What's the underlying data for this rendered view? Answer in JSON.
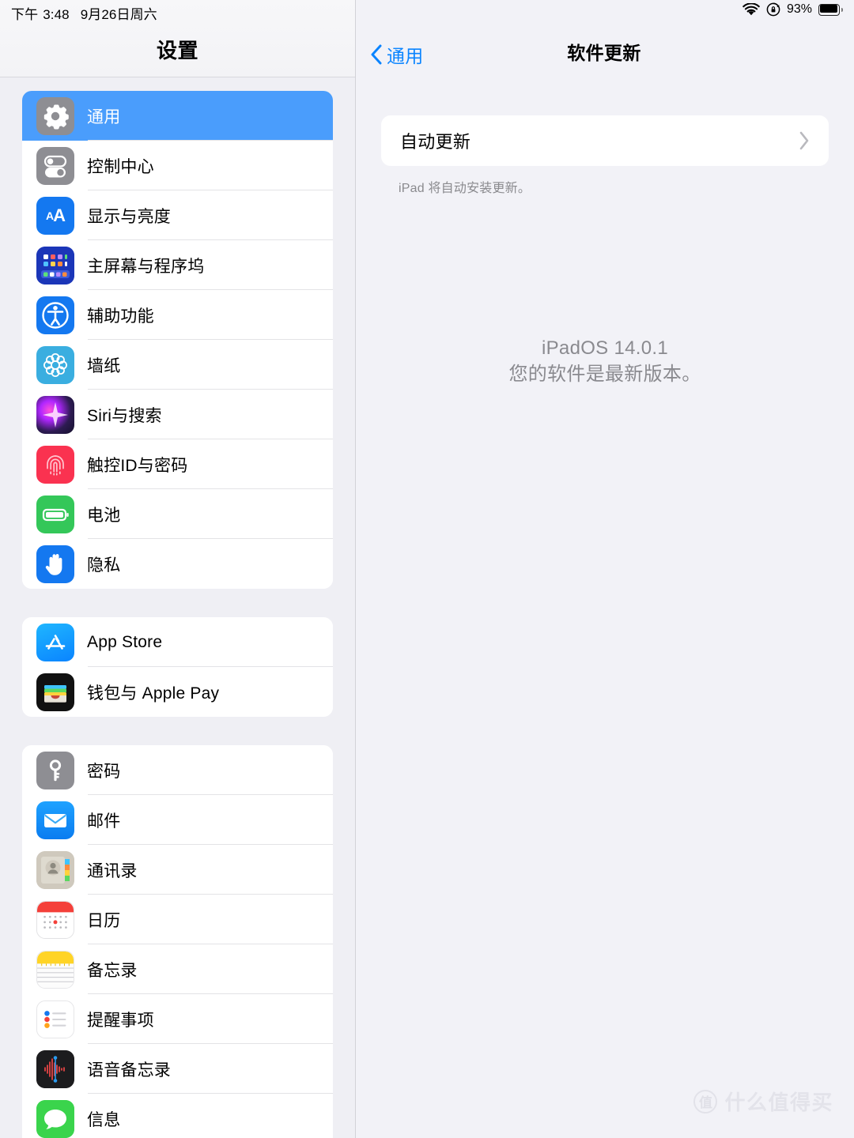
{
  "status_bar": {
    "ampm": "下午",
    "time": "3:48",
    "date": "9月26日周六",
    "wifi_icon": "wifi-icon",
    "rotation_lock_icon": "rotation-lock-icon",
    "battery_percent": "93%",
    "battery_level": 93,
    "battery_icon": "battery-icon"
  },
  "sidebar": {
    "title": "设置",
    "groups": [
      {
        "items": [
          {
            "label": "通用",
            "icon": "gear-icon",
            "selected": true
          },
          {
            "label": "控制中心",
            "icon": "control-center-icon",
            "selected": false
          },
          {
            "label": "显示与亮度",
            "icon": "display-brightness-icon",
            "selected": false
          },
          {
            "label": "主屏幕与程序坞",
            "icon": "home-screen-dock-icon",
            "selected": false
          },
          {
            "label": "辅助功能",
            "icon": "accessibility-icon",
            "selected": false
          },
          {
            "label": "墙纸",
            "icon": "wallpaper-icon",
            "selected": false
          },
          {
            "label": "Siri与搜索",
            "icon": "siri-icon",
            "selected": false
          },
          {
            "label": "触控ID与密码",
            "icon": "touch-id-icon",
            "selected": false
          },
          {
            "label": "电池",
            "icon": "battery-settings-icon",
            "selected": false
          },
          {
            "label": "隐私",
            "icon": "privacy-hand-icon",
            "selected": false
          }
        ]
      },
      {
        "items": [
          {
            "label": "App Store",
            "icon": "app-store-icon",
            "selected": false
          },
          {
            "label": "钱包与 Apple Pay",
            "icon": "wallet-icon",
            "selected": false
          }
        ]
      },
      {
        "items": [
          {
            "label": "密码",
            "icon": "passwords-key-icon",
            "selected": false
          },
          {
            "label": "邮件",
            "icon": "mail-icon",
            "selected": false
          },
          {
            "label": "通讯录",
            "icon": "contacts-icon",
            "selected": false
          },
          {
            "label": "日历",
            "icon": "calendar-icon",
            "selected": false
          },
          {
            "label": "备忘录",
            "icon": "notes-icon",
            "selected": false
          },
          {
            "label": "提醒事项",
            "icon": "reminders-icon",
            "selected": false
          },
          {
            "label": "语音备忘录",
            "icon": "voice-memos-icon",
            "selected": false
          },
          {
            "label": "信息",
            "icon": "messages-icon",
            "selected": false
          }
        ]
      }
    ]
  },
  "detail": {
    "back_label": "通用",
    "back_icon": "chevron-left-icon",
    "title": "软件更新",
    "auto_update_row": {
      "label": "自动更新",
      "chevron_icon": "chevron-right-icon"
    },
    "footer_note": "iPad 将自动安装更新。",
    "version_line": "iPadOS 14.0.1",
    "status_line": "您的软件是最新版本。"
  },
  "watermark": {
    "badge": "值",
    "text": "什么值得买"
  },
  "colors": {
    "accent_blue": "#0a84ff",
    "selected_row": "#4a9dfc",
    "pane_background": "#f2f2f7",
    "sidebar_background": "#efeff4",
    "card_white": "#ffffff",
    "secondary_text": "#8a8a8f"
  }
}
